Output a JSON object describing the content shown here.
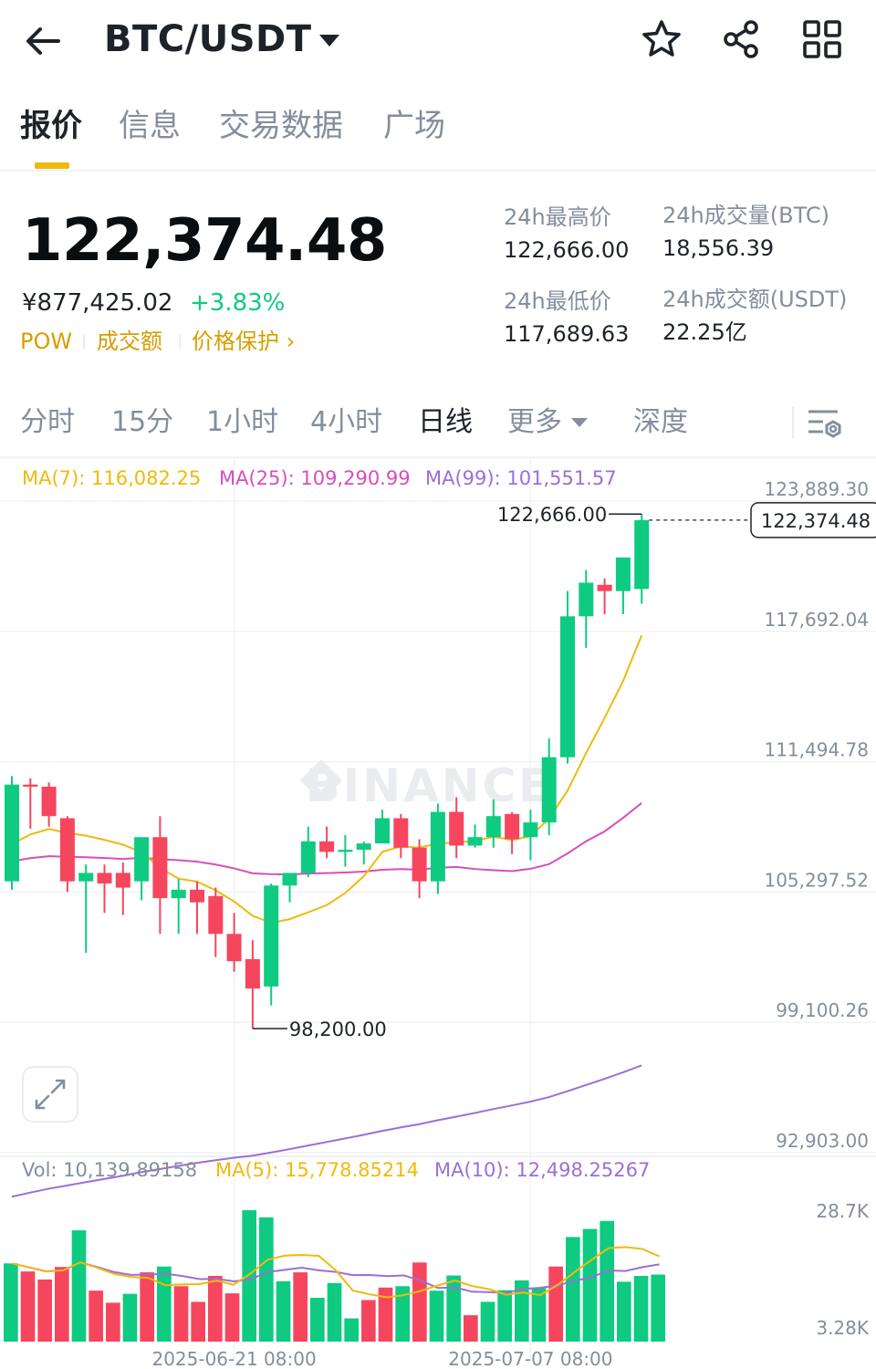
{
  "header": {
    "pair": "BTC/USDT",
    "back_icon": "arrow-left-icon",
    "icons": [
      "star-icon",
      "share-icon",
      "grid-menu-icon"
    ]
  },
  "tabs": [
    {
      "label": "报价",
      "active": true
    },
    {
      "label": "信息",
      "active": false
    },
    {
      "label": "交易数据",
      "active": false
    },
    {
      "label": "广场",
      "active": false
    }
  ],
  "ticker": {
    "last_price": "122,374.48",
    "cny_price": "¥877,425.02",
    "change_pct": "+3.83%",
    "tags": [
      "POW",
      "成交额",
      "价格保护 ›"
    ],
    "stats": {
      "high_label": "24h最高价",
      "high_value": "122,666.00",
      "low_label": "24h最低价",
      "low_value": "117,689.63",
      "vol_btc_label": "24h成交量(BTC)",
      "vol_btc_value": "18,556.39",
      "vol_usdt_label": "24h成交额(USDT)",
      "vol_usdt_value": "22.25亿"
    }
  },
  "intervals": {
    "items": [
      "分时",
      "15分",
      "1小时",
      "4小时",
      "日线",
      "更多",
      "深度"
    ],
    "active": "日线",
    "settings_icon": "chart-settings-icon"
  },
  "colors": {
    "up": "#0ecb81",
    "down": "#f6465d",
    "accent": "#f0b90b",
    "ma7": "#f0b90b",
    "ma25": "#d64ebc",
    "ma99": "#9b6fd6"
  },
  "chart_data": {
    "type": "candlestick",
    "watermark": "BINANCE",
    "ma_labels": {
      "ma7": "MA(7): 116,082.25",
      "ma25": "MA(25): 109,290.99",
      "ma99": "MA(99): 101,551.57"
    },
    "y_ticks": [
      "123,889.30",
      "117,692.04",
      "111,494.78",
      "105,297.52",
      "99,100.26",
      "92,903.00"
    ],
    "y_tick_values": [
      123889.3,
      117692.04,
      111494.78,
      105297.52,
      99100.26,
      92903.0
    ],
    "ylim": [
      92903.0,
      123889.3
    ],
    "current_price_label": "122,374.48",
    "current_price": 122374.48,
    "max_label": "122,666.00",
    "min_label": "98,200.00",
    "x_labels": [
      "2025-06-21 08:00",
      "2025-07-07 08:00"
    ],
    "x_label_indices": [
      12,
      28
    ],
    "candles": [
      [
        105200,
        110200,
        104800,
        109800
      ],
      [
        109800,
        110100,
        107700,
        109700
      ],
      [
        109700,
        109900,
        107800,
        108300
      ],
      [
        108200,
        108300,
        104700,
        105200
      ],
      [
        105200,
        106000,
        101800,
        105600
      ],
      [
        105600,
        106000,
        103700,
        105100
      ],
      [
        105600,
        106100,
        103600,
        104900
      ],
      [
        105200,
        106400,
        104300,
        107300
      ],
      [
        107300,
        108300,
        102700,
        104400
      ],
      [
        104400,
        105300,
        102700,
        104800
      ],
      [
        104800,
        105200,
        102700,
        104200
      ],
      [
        104500,
        104900,
        101600,
        102700
      ],
      [
        102700,
        103700,
        100900,
        101400
      ],
      [
        101500,
        102400,
        98200,
        100100
      ],
      [
        100200,
        105100,
        99300,
        105000
      ],
      [
        105000,
        105500,
        104200,
        105600
      ],
      [
        105600,
        107800,
        105400,
        107100
      ],
      [
        107100,
        107800,
        106300,
        106600
      ],
      [
        106600,
        107400,
        105900,
        106700
      ],
      [
        106700,
        107100,
        106000,
        107000
      ],
      [
        107000,
        108600,
        107100,
        108200
      ],
      [
        108200,
        108400,
        106300,
        106800
      ],
      [
        106800,
        107200,
        104400,
        105200
      ],
      [
        105200,
        108900,
        104600,
        108500
      ],
      [
        108500,
        109200,
        106300,
        106900
      ],
      [
        106900,
        107900,
        106800,
        107300
      ],
      [
        107300,
        109100,
        106800,
        108300
      ],
      [
        108400,
        108500,
        106500,
        107200
      ],
      [
        107300,
        108600,
        106200,
        108000
      ],
      [
        108000,
        112000,
        107400,
        111100
      ],
      [
        111100,
        119000,
        110800,
        117800
      ],
      [
        117800,
        120000,
        116300,
        119400
      ],
      [
        119300,
        119600,
        117900,
        119000
      ],
      [
        119000,
        120400,
        117900,
        120600
      ],
      [
        119100,
        122666,
        118400,
        122374.48
      ]
    ],
    "volume": {
      "label": "Vol: 10,139.89158",
      "ma5_label": "MA(5): 15,778.85214",
      "ma10_label": "MA(10): 12,498.25267",
      "y_ticks": [
        "28.7K",
        "3.28K"
      ],
      "values": [
        17500,
        15700,
        13900,
        16700,
        24900,
        11400,
        8700,
        10700,
        15500,
        16800,
        12400,
        8900,
        14700,
        10800,
        29400,
        27800,
        13500,
        15500,
        9800,
        13100,
        5200,
        9300,
        12100,
        12400,
        17700,
        11400,
        14800,
        5900,
        8900,
        11500,
        13700,
        12100,
        16800,
        23400,
        25200,
        27000,
        13400,
        14700,
        15000
      ]
    }
  }
}
